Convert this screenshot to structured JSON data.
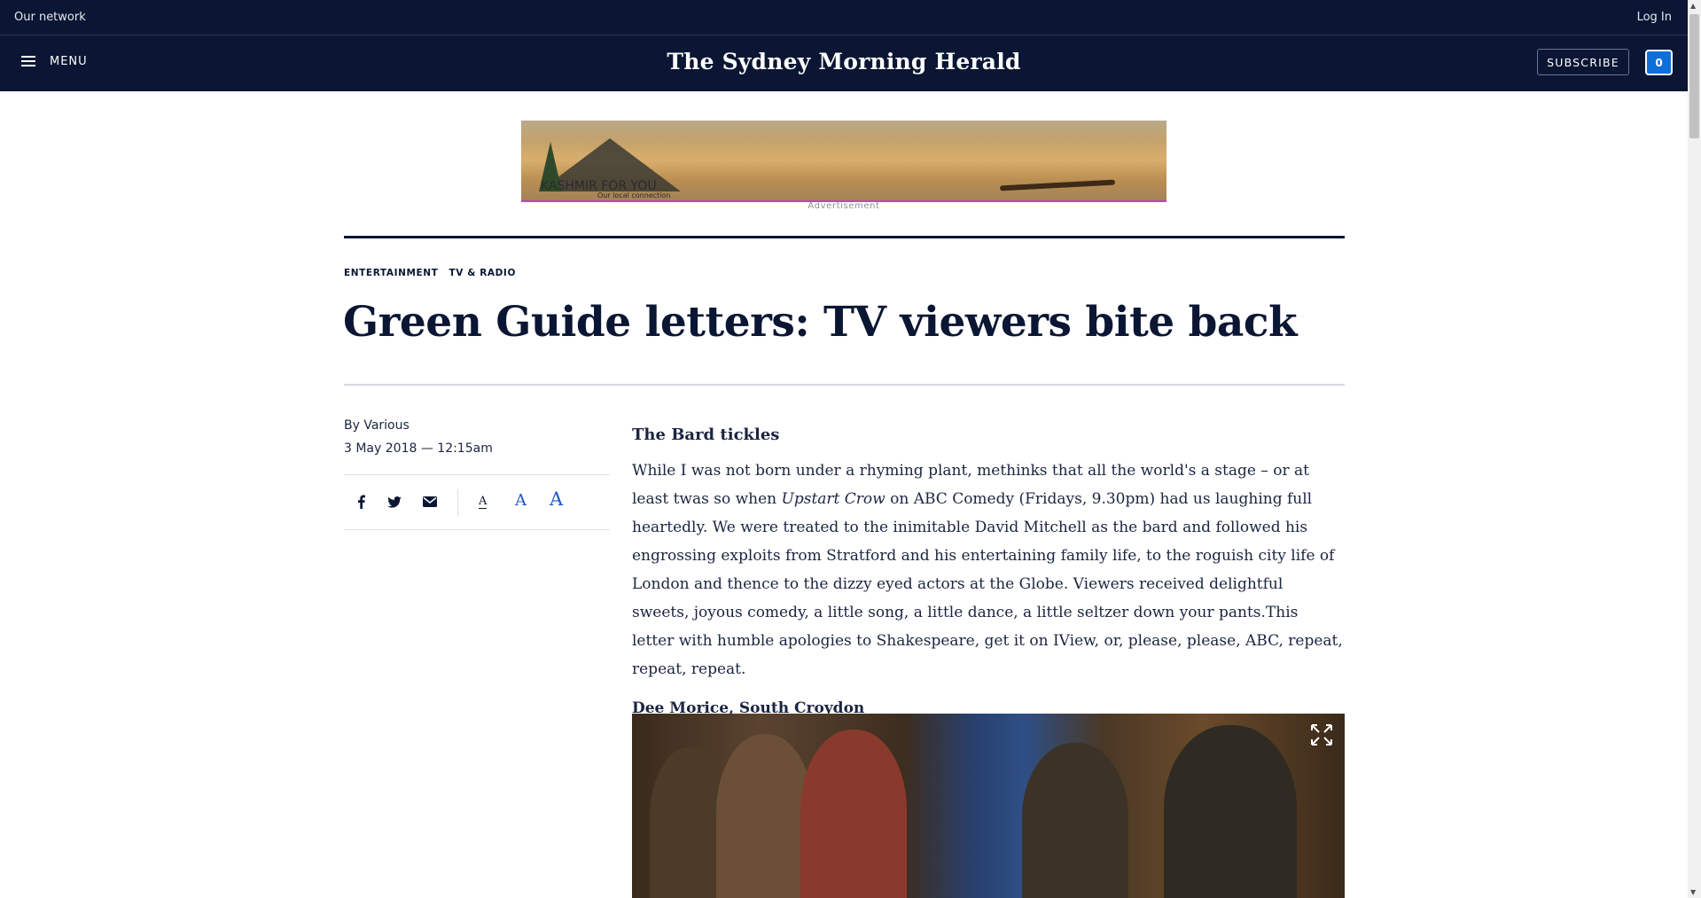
{
  "network_bar": {
    "our_network": "Our network",
    "login": "Log In"
  },
  "header": {
    "menu_label": "MENU",
    "masthead": "The Sydney Morning Herald",
    "subscribe_label": "SUBSCRIBE",
    "cart_count": "0"
  },
  "ad": {
    "brand": "KASHMIR FOR YOU",
    "tagline": "Our local connection",
    "label": "Advertisement"
  },
  "article": {
    "kickers": [
      "ENTERTAINMENT",
      "TV & RADIO"
    ],
    "headline": "Green Guide letters: TV viewers bite back",
    "byline": "By Various",
    "date": "3 May 2018 — 12:15am",
    "font_size_labels": [
      "A",
      "A",
      "A"
    ],
    "subhead": "The Bard tickles",
    "para_before_italic": "While I was not born under a rhyming plant, methinks that all the world's a stage – or at least twas so when ",
    "para_italic": "Upstart Crow",
    "para_after_italic": " on ABC Comedy (Fridays, 9.30pm) had us laughing full heartedly. We were treated to the inimitable David Mitchell as the bard and followed his engrossing exploits from Stratford and his entertaining family life, to the roguish city life of London and thence to the dizzy eyed actors at the Globe. Viewers received delightful sweets, joyous comedy, a little song, a little dance, a little seltzer down your pants.This letter with humble apologies to Shakespeare, get it on IView, or, please, please, ABC, repeat, repeat, repeat.",
    "signoff": "Dee Morice, South Croydon"
  },
  "colors": {
    "navy": "#0a1633",
    "accent_blue": "#1a56c9",
    "cart_blue": "#0f6fd9"
  },
  "icons": [
    "hamburger-icon",
    "facebook-icon",
    "twitter-icon",
    "email-icon",
    "expand-icon"
  ]
}
